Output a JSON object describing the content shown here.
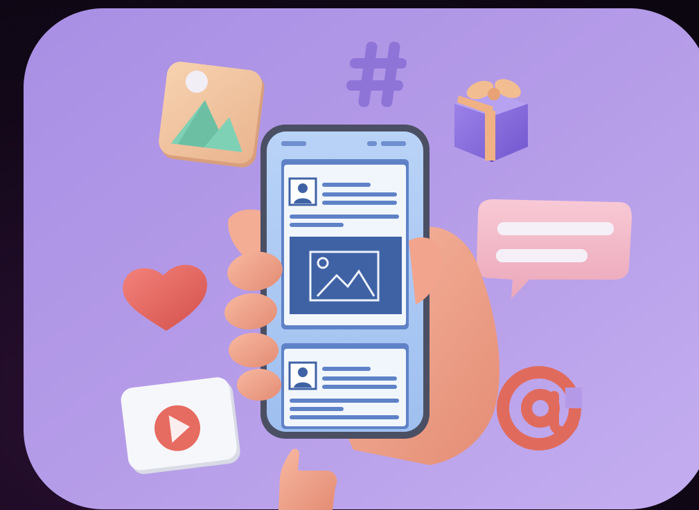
{
  "scene": {
    "icons": [
      "image-icon",
      "hashtag-icon",
      "gift-icon",
      "chat-bubble-icon",
      "heart-icon",
      "play-icon",
      "at-sign-icon",
      "thumbs-up-icon"
    ],
    "colors": {
      "page_background": "#120818",
      "card_background": "#b49ae6",
      "phone_frame": "#4a4f63",
      "phone_screen": "#a9c8f2",
      "post_image": "#3f62a5",
      "skin": "#f2a48c",
      "heart": "#e9665e",
      "chat_bubble": "#f3b9c9",
      "gift": "#8c6fde",
      "at_sign": "#e06b5d"
    }
  }
}
